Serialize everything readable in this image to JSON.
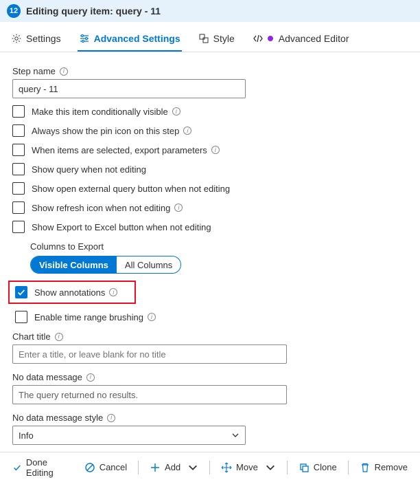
{
  "header": {
    "badge": "12",
    "title": "Editing query item: query - 11"
  },
  "tabs": {
    "settings": "Settings",
    "advanced": "Advanced Settings",
    "style": "Style",
    "advanced_editor": "Advanced Editor"
  },
  "form": {
    "step_name_label": "Step name",
    "step_name_value": "query - 11",
    "checks": {
      "conditional": "Make this item conditionally visible",
      "pin": "Always show the pin icon on this step",
      "export_params": "When items are selected, export parameters",
      "show_query": "Show query when not editing",
      "open_external": "Show open external query button when not editing",
      "refresh": "Show refresh icon when not editing",
      "excel": "Show Export to Excel button when not editing",
      "annotations": "Show annotations",
      "brushing": "Enable time range brushing"
    },
    "columns_label": "Columns to Export",
    "columns_options": {
      "visible": "Visible Columns",
      "all": "All Columns"
    },
    "chart_title_label": "Chart title",
    "chart_title_placeholder": "Enter a title, or leave blank for no title",
    "nodata_label": "No data message",
    "nodata_value": "The query returned no results.",
    "nodata_style_label": "No data message style",
    "nodata_style_value": "Info"
  },
  "footer": {
    "done": "Done Editing",
    "cancel": "Cancel",
    "add": "Add",
    "move": "Move",
    "clone": "Clone",
    "remove": "Remove"
  }
}
